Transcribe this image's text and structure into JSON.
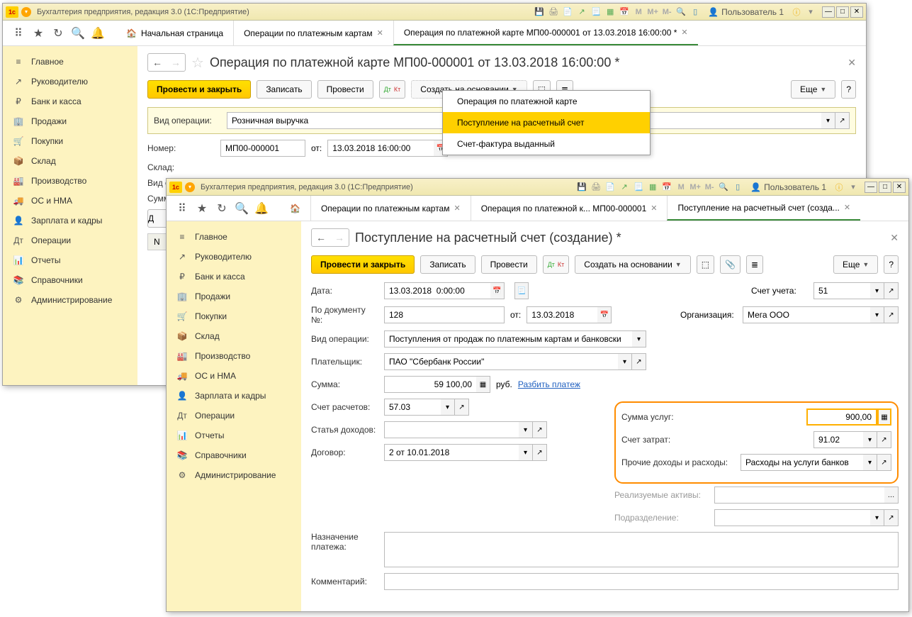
{
  "app_title": "Бухгалтерия предприятия, редакция 3.0  (1С:Предприятие)",
  "user": "Пользователь 1",
  "sidebar": [
    {
      "icon": "≡",
      "label": "Главное"
    },
    {
      "icon": "↗",
      "label": "Руководителю"
    },
    {
      "icon": "₽",
      "label": "Банк и касса"
    },
    {
      "icon": "🏢",
      "label": "Продажи"
    },
    {
      "icon": "🛒",
      "label": "Покупки"
    },
    {
      "icon": "📦",
      "label": "Склад"
    },
    {
      "icon": "🏭",
      "label": "Производство"
    },
    {
      "icon": "🚚",
      "label": "ОС и НМА"
    },
    {
      "icon": "👤",
      "label": "Зарплата и кадры"
    },
    {
      "icon": "Дт",
      "label": "Операции"
    },
    {
      "icon": "📊",
      "label": "Отчеты"
    },
    {
      "icon": "📚",
      "label": "Справочники"
    },
    {
      "icon": "⚙",
      "label": "Администрирование"
    }
  ],
  "win1": {
    "tabs": {
      "home": "Начальная страница",
      "t1": "Операции по платежным картам",
      "t2": "Операция по платежной карте МП00-000001 от 13.03.2018 16:00:00 *"
    },
    "page_title": "Операция по платежной карте МП00-000001 от 13.03.2018 16:00:00 *",
    "buttons": {
      "post_close": "Провести и закрыть",
      "save": "Записать",
      "post": "Провести",
      "create_based": "Создать на основании",
      "more": "Еще"
    },
    "menu": {
      "i1": "Операция по платежной карте",
      "i2": "Поступление на расчетный счет",
      "i3": "Счет-фактура выданный"
    },
    "form": {
      "op_type_label": "Вид операции:",
      "op_type": "Розничная выручка",
      "number_label": "Номер:",
      "number": "МП00-000001",
      "from_label": "от:",
      "date": "13.03.2018 16:00:00",
      "warehouse_label": "Склад:",
      "op_kind_label": "Вид оп",
      "sum_label": "Сумм",
      "d_label": "Д",
      "n_label": "N"
    }
  },
  "win2": {
    "tabs": {
      "t1": "Операции по платежным картам",
      "t2": "Операция по платежной к... МП00-000001",
      "t3": "Поступление на расчетный счет (созда..."
    },
    "page_title": "Поступление на расчетный счет (создание) *",
    "buttons": {
      "post_close": "Провести и закрыть",
      "save": "Записать",
      "post": "Провести",
      "create_based": "Создать на основании",
      "more": "Еще"
    },
    "form": {
      "date_label": "Дата:",
      "date": "13.03.2018  0:00:00",
      "account_label": "Счет учета:",
      "account": "51",
      "docnum_label": "По документу №:",
      "docnum": "128",
      "from_label": "от:",
      "docdate": "13.03.2018",
      "org_label": "Организация:",
      "org": "Мега ООО",
      "optype_label": "Вид операции:",
      "optype": "Поступления от продаж по платежным картам и банковски",
      "payer_label": "Плательщик:",
      "payer": "ПАО \"Сбербанк России\"",
      "sum_label": "Сумма:",
      "sum": "59 100,00",
      "currency": "руб.",
      "split": "Разбить платеж",
      "settle_acc_label": "Счет расчетов:",
      "settle_acc": "57.03",
      "service_sum_label": "Сумма услуг:",
      "service_sum": "900,00",
      "income_item_label": "Статья доходов:",
      "expense_acc_label": "Счет затрат:",
      "expense_acc": "91.02",
      "contract_label": "Договор:",
      "contract": "2 от 10.01.2018",
      "other_label": "Прочие доходы и расходы:",
      "other": "Расходы на услуги банков",
      "assets_label": "Реализуемые активы:",
      "division_label": "Подразделение:",
      "purpose_label": "Назначение платежа:",
      "comment_label": "Комментарий:"
    }
  }
}
